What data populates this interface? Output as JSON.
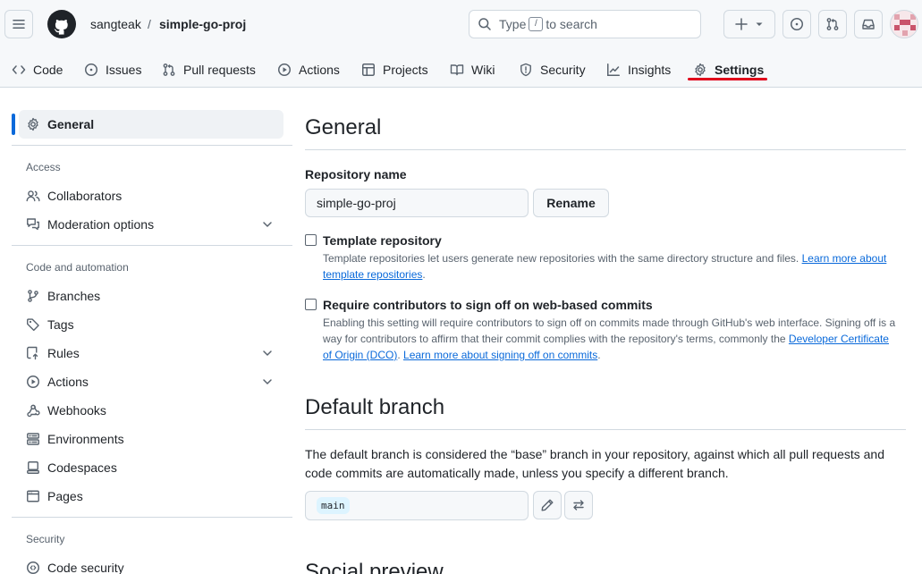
{
  "header": {
    "owner": "sangteak",
    "separator": "/",
    "repo": "simple-go-proj",
    "search_prefix": "Type",
    "search_key": "/",
    "search_suffix": "to search"
  },
  "nav": {
    "code": "Code",
    "issues": "Issues",
    "pull_requests": "Pull requests",
    "actions": "Actions",
    "projects": "Projects",
    "wiki": "Wiki",
    "security": "Security",
    "insights": "Insights",
    "settings": "Settings"
  },
  "sidebar": {
    "general": "General",
    "access_heading": "Access",
    "collaborators": "Collaborators",
    "moderation": "Moderation options",
    "code_automation_heading": "Code and automation",
    "branches": "Branches",
    "tags": "Tags",
    "rules": "Rules",
    "actions": "Actions",
    "webhooks": "Webhooks",
    "environments": "Environments",
    "codespaces": "Codespaces",
    "pages": "Pages",
    "security_heading": "Security",
    "code_security": "Code security"
  },
  "main": {
    "title": "General",
    "repo_name_label": "Repository name",
    "repo_name_value": "simple-go-proj",
    "rename_button": "Rename",
    "template_label": "Template repository",
    "template_desc": "Template repositories let users generate new repositories with the same directory structure and files.",
    "template_link_1": "Learn more about",
    "template_link_2": "template repositories",
    "signoff_label": "Require contributors to sign off on web-based commits",
    "signoff_desc_1": "Enabling this setting will require contributors to sign off on commits made through GitHub's web interface. Signing off is a",
    "signoff_desc_2": "way for contributors to affirm that their commit complies with the repository's terms, commonly the",
    "signoff_link_dco_1": "Developer Certificate",
    "signoff_link_dco_2": "of Origin (DCO)",
    "signoff_link_more": "Learn more about signing off on commits",
    "default_branch_title": "Default branch",
    "default_branch_desc": "The default branch is considered the “base” branch in your repository, against which all pull requests and code commits are automatically made, unless you specify a different branch.",
    "default_branch_value": "main",
    "social_preview_title": "Social preview"
  }
}
